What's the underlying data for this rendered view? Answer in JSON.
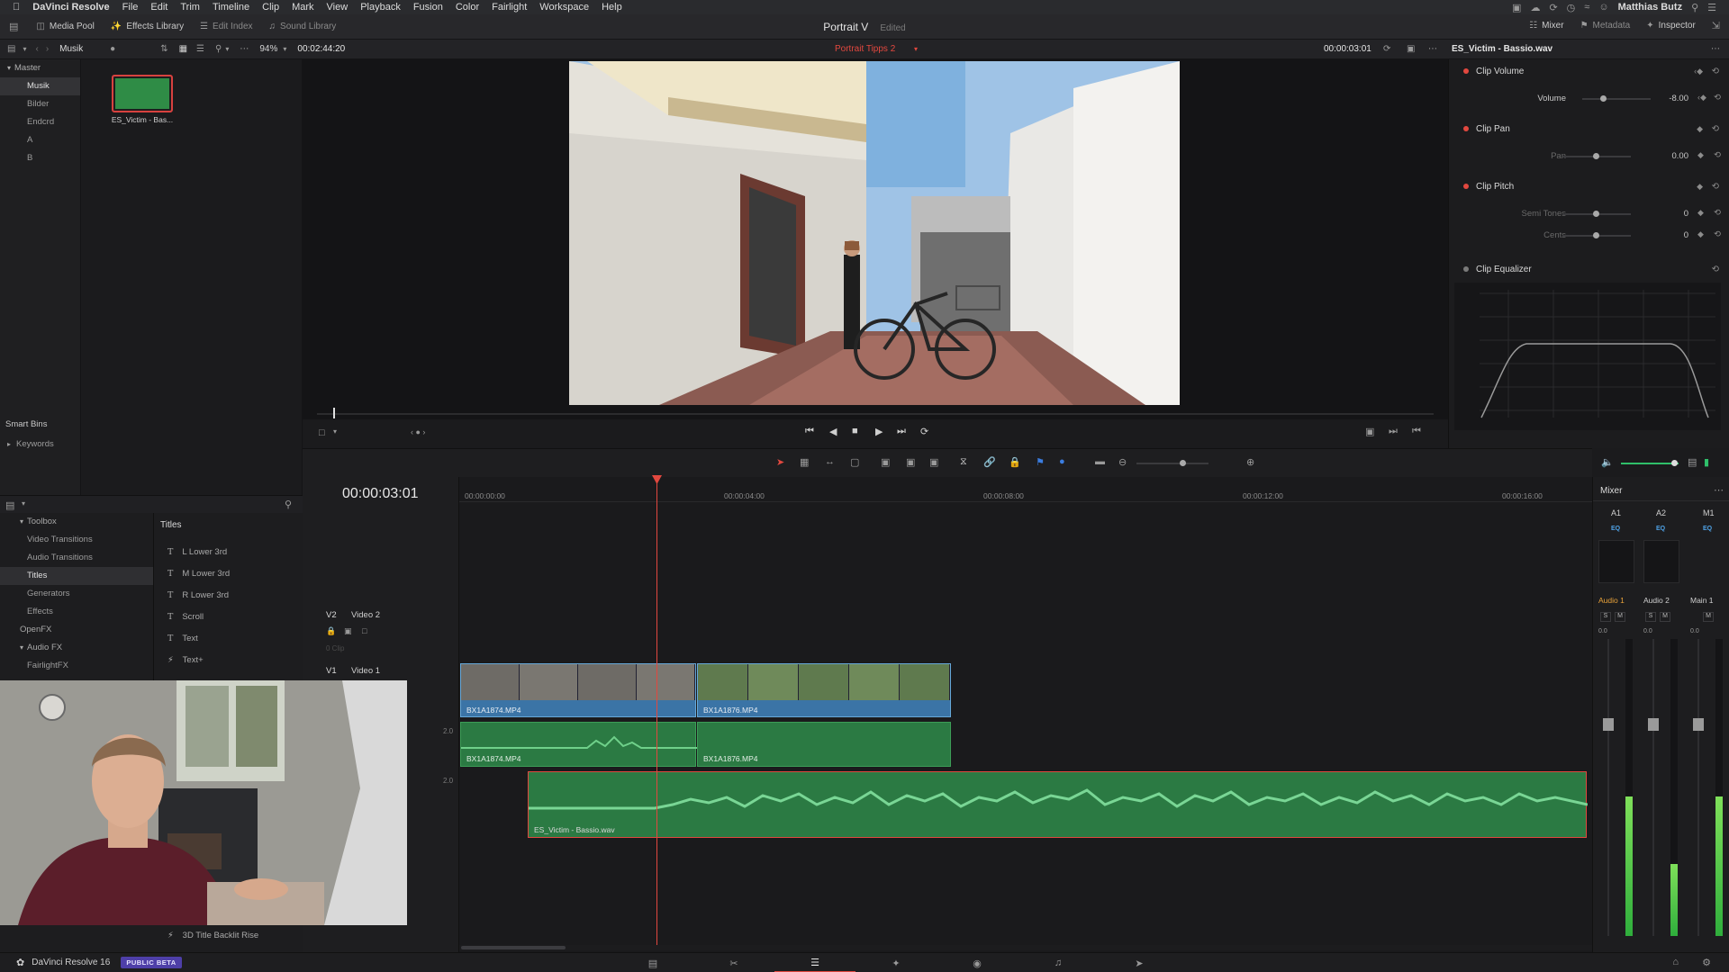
{
  "menubar": {
    "app": "DaVinci Resolve",
    "items": [
      "File",
      "Edit",
      "Trim",
      "Timeline",
      "Clip",
      "Mark",
      "View",
      "Playback",
      "Fusion",
      "Color",
      "Fairlight",
      "Workspace",
      "Help"
    ],
    "user": "Matthias Butz"
  },
  "toolbar": {
    "media_pool": "Media Pool",
    "effects_library": "Effects Library",
    "edit_index": "Edit Index",
    "sound_library": "Sound Library",
    "project_title": "Portrait V",
    "project_status": "Edited",
    "mixer": "Mixer",
    "metadata": "Metadata",
    "inspector": "Inspector"
  },
  "subbar": {
    "bin_name": "Musik",
    "zoom": "94%",
    "duration": "00:02:44:20",
    "timeline_name": "Portrait Tipps 2",
    "timecode": "00:00:03:01",
    "inspector_clip": "ES_Victim - Bassio.wav"
  },
  "bins": {
    "master": "Master",
    "items": [
      "Musik",
      "Bilder",
      "Endcrd",
      "A",
      "B"
    ],
    "smart_bins": "Smart Bins",
    "keywords": "Keywords"
  },
  "media": {
    "clip_label": "ES_Victim - Bas...",
    "clip_color": "#2f8c46"
  },
  "inspector": {
    "clip_volume": "Clip Volume",
    "volume_label": "Volume",
    "volume_value": "-8.00",
    "clip_pan": "Clip Pan",
    "pan_label": "Pan",
    "pan_value": "0.00",
    "clip_pitch": "Clip Pitch",
    "semitones_label": "Semi Tones",
    "semitones_value": "0",
    "cents_label": "Cents",
    "cents_value": "0",
    "clip_eq": "Clip Equalizer"
  },
  "effects": {
    "toolbox": "Toolbox",
    "items": [
      "Video Transitions",
      "Audio Transitions",
      "Titles",
      "Generators",
      "Effects"
    ],
    "openfx": "OpenFX",
    "audiofx": "Audio FX",
    "fairlightfx": "FairlightFX",
    "titles_header": "Titles",
    "titles": [
      "L Lower 3rd",
      "M Lower 3rd",
      "R Lower 3rd",
      "Scroll",
      "Text",
      "Text+"
    ],
    "bottom_title": "3D Title Backlit Rise"
  },
  "timeline": {
    "timecode": "00:00:03:01",
    "ruler": [
      "00:00:00:00",
      "00:00:04:00",
      "00:00:08:00",
      "00:00:12:00",
      "00:00:16:00"
    ],
    "v2_id": "V2",
    "v2_name": "Video 2",
    "v2_clip_count": "0 Clip",
    "v1_id": "V1",
    "v1_name": "Video 1",
    "a1_level": "2.0",
    "a2_level": "2.0",
    "clips": {
      "v1_a": "BX1A1874.MP4",
      "v1_b": "BX1A1876.MP4",
      "a1_a": "BX1A1874.MP4",
      "a1_b": "BX1A1876.MP4",
      "a2": "ES_Victim - Bassio.wav"
    }
  },
  "mixer": {
    "title": "Mixer",
    "channels": [
      "A1",
      "A2",
      "M1"
    ],
    "eq": "EQ",
    "names": [
      "Audio 1",
      "Audio 2",
      "Main 1"
    ],
    "solo": "S",
    "mute": "M",
    "fader_value": "0.0"
  },
  "statusbar": {
    "app": "DaVinci Resolve 16",
    "badge": "PUBLIC BETA"
  },
  "colors": {
    "accent_red": "#e2483f",
    "video_clip": "#3b74a6",
    "audio_clip": "#2b7a43",
    "badge": "#4e3fa8"
  }
}
